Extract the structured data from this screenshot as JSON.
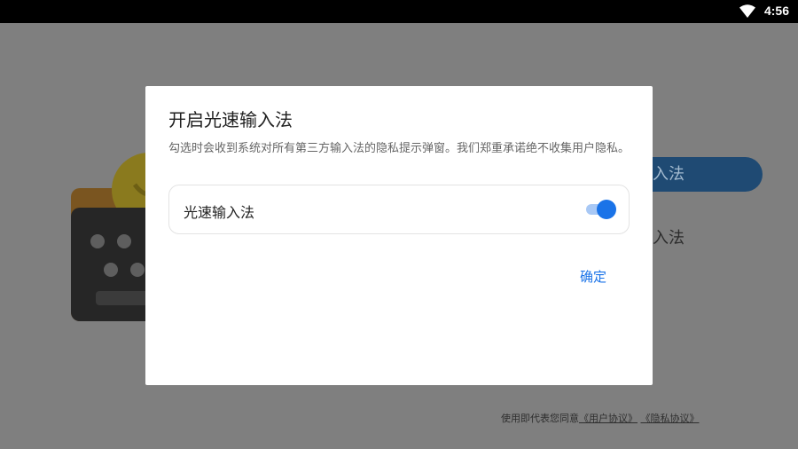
{
  "status_bar": {
    "time": "4:56",
    "wifi_icon": "wifi-icon"
  },
  "background": {
    "primary_button_label_partial": "入法",
    "secondary_link_partial": "入法",
    "footer": {
      "prefix": "使用即代表您同意",
      "user_agreement": "《用户协议》",
      "privacy_policy": "《隐私协议》"
    }
  },
  "dialog": {
    "title": "开启光速输入法",
    "description": "勾选时会收到系统对所有第三方输入法的隐私提示弹窗。我们郑重承诺绝不收集用户隐私。",
    "toggle": {
      "label": "光速输入法",
      "checked": true,
      "accent": "#1a73e8"
    },
    "confirm_label": "确定"
  }
}
